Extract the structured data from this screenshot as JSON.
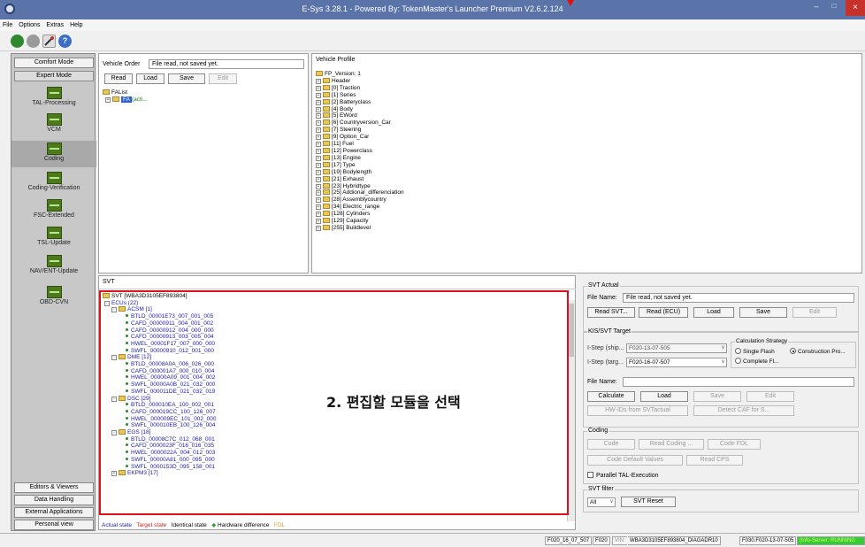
{
  "window": {
    "title": "E-Sys 3.28.1 - Powered By: TokenMaster's Launcher Premium V2.6.2.124",
    "minimize_glyph": "–",
    "maximize_glyph": "□",
    "close_glyph": "×"
  },
  "menu": [
    "File",
    "Options",
    "Extras",
    "Help"
  ],
  "left_nav": {
    "top_buttons": [
      "Comfort Mode",
      "Expert Mode"
    ],
    "items": [
      "TAL-Processing",
      "VCM",
      "Coding",
      "Coding-Verification",
      "FSC-Extended",
      "TSL-Update",
      "NAV/ENT-Update",
      "OBD-CVN"
    ],
    "bottom_buttons": [
      "Editors & Viewers",
      "Data Handling",
      "External Applications",
      "Personal view"
    ]
  },
  "vehicle_order": {
    "label": "Vehicle Order",
    "value": "File read, not saved yet.",
    "buttons": [
      "Read",
      "Load",
      "Save",
      "Edit"
    ],
    "tree_root": "FAList",
    "tree_child": "FA",
    "tree_child_suffix": "(acti..."
  },
  "vehicle_profile": {
    "header": "Vehicle Profile",
    "root": "FP_Version: 1",
    "items": [
      "Header",
      "[0] Traction",
      "[1] Series",
      "[2] Batteryclass",
      "[4] Body",
      "[5] EWord",
      "[6] Countryversion_Car",
      "[7] Steering",
      "[9] Option_Car",
      "[11] Fuel",
      "[12] Powerclass",
      "[13] Engine",
      "[17] Type",
      "[19] Bodylength",
      "[21] Exhaust",
      "[23] Hybridtype",
      "[25] Addional_differenciation",
      "[28] Assemblycountry",
      "[34] Electric_range",
      "[128] Cylinders",
      "[129] Capacity",
      "[255] Buildlevel"
    ]
  },
  "svt": {
    "header": "SVT",
    "root": "SVT [WBA3D3105EF893804]",
    "ecus_label": "ECUs (22)",
    "groups": [
      {
        "name": "ACSM [1]",
        "items": [
          "BTLD_00001E73_007_001_005",
          "CAFD_00000911_004_001_002",
          "CAFD_00000912_004_000_000",
          "CAFD_00000913_003_005_004",
          "HWEL_00001F17_007_000_000",
          "SWFL_00000910_012_001_000"
        ]
      },
      {
        "name": "DME [12]",
        "items": [
          "BTLD_00008A0A_006_026_000",
          "CAFD_000001A7_000_010_004",
          "HWEL_00000A09_001_004_002",
          "SWFL_00000A0B_021_032_000",
          "SWFL_000011DE_021_032_019"
        ]
      },
      {
        "name": "DSC [29]",
        "items": [
          "BTLD_000010EA_100_002_001",
          "CAFD_000019CC_100_126_007",
          "HWEL_000009EC_101_002_000",
          "SWFL_000010EB_100_126_004"
        ]
      },
      {
        "name": "EGS [18]",
        "items": [
          "BTLD_00008C7C_012_068_001",
          "CAFD_0000023F_016_016_035",
          "HWEL_0000022A_004_012_003",
          "SWFL_00000A81_000_095_000",
          "SWFL_0000153D_095_158_001"
        ]
      }
    ],
    "next_group_partial": "EKPM3 [17]",
    "annotation": "2. 편집할 모듈을 선택",
    "legend": {
      "actual": "Actual state",
      "target": "Target state",
      "identical": "Identical state",
      "hw_diff": "Hardware difference",
      "fdl": "FDL"
    }
  },
  "svt_actual": {
    "label": "SVT Actual",
    "file_label": "File Name:",
    "file_value": "File read, not saved yet.",
    "buttons": [
      "Read SVT...",
      "Read (ECU)",
      "Load",
      "Save",
      "Edit"
    ]
  },
  "kis": {
    "label": "KIS/SVT Target",
    "istep_ship_label": "I-Step (ship...",
    "istep_ship_value": "F020-13-07-505",
    "istep_target_label": "I-Step (targ...",
    "istep_target_value": "F020-16-07-507",
    "calc_label": "Calculation Strategy",
    "opt_single": "Single Flash",
    "opt_construction": "Construction Pro...",
    "opt_complete": "Complete Fl...",
    "file_label": "File Name:",
    "buttons": [
      "Calculate",
      "Load",
      "Save",
      "Edit"
    ],
    "hw_button": "HW-IDs from SVTactual",
    "detect_button": "Detect CAF for S..."
  },
  "coding": {
    "label": "Coding",
    "buttons_row1": [
      "Code",
      "Read Coding ...",
      "Code FDL"
    ],
    "buttons_row2": [
      "Code Default Values",
      "Read CPS"
    ],
    "parallel_label": "Parallel TAL-Execution"
  },
  "svt_filter": {
    "label": "SVT filter",
    "value": "All",
    "reset": "SVT Reset"
  },
  "status": [
    "F020_16_07_507",
    "F020",
    "VIN:",
    "WBA3D3105EF893804_DIAGADR10",
    "F030.F020-13-07-505",
    "(Info-Server: RUNNING"
  ],
  "colors": {
    "title_bg": "#5a73a8",
    "annotation_border": "#e0101a",
    "actual": "#1b1bb0",
    "target": "#d02020",
    "identical": "#000000",
    "hw_diff": "#3aa03a",
    "fdl": "#e0a020",
    "server_ok": "#33cc33"
  }
}
